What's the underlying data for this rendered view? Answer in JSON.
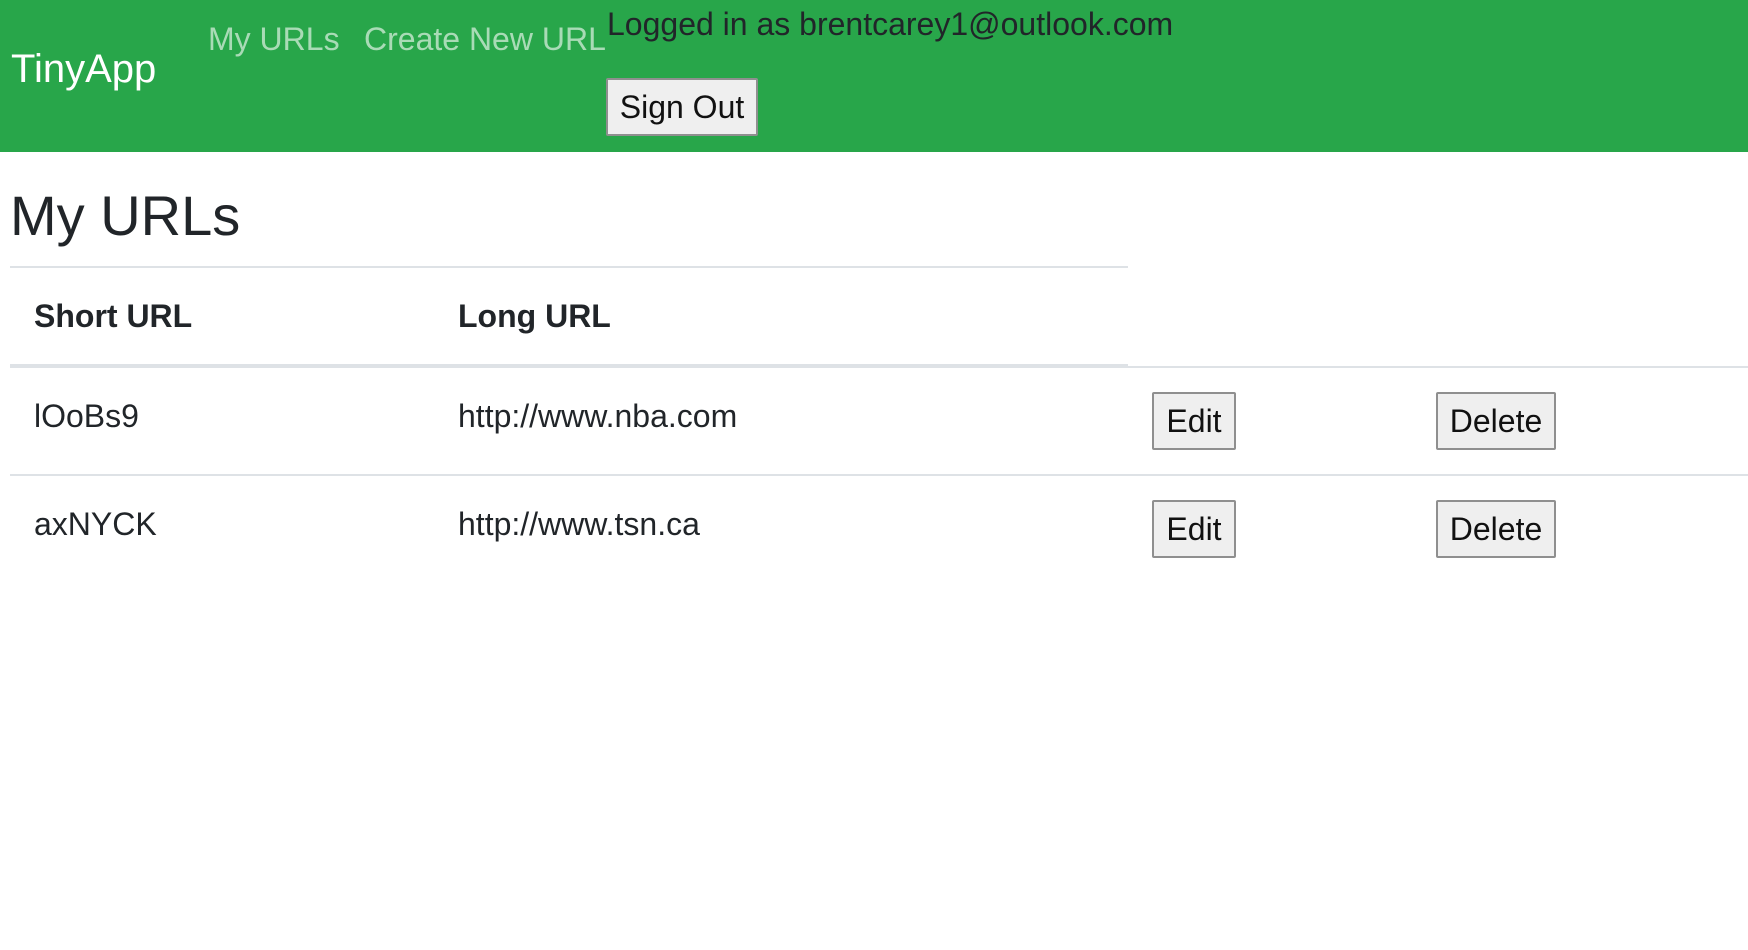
{
  "navbar": {
    "brand": "TinyApp",
    "links": [
      {
        "label": "My URLs"
      },
      {
        "label": "Create New URL"
      }
    ],
    "login_text": "Logged in as brentcarey1@outlook.com",
    "signout_label": "Sign Out"
  },
  "main": {
    "title": "My URLs",
    "table": {
      "headers": [
        "Short URL",
        "Long URL"
      ],
      "rows": [
        {
          "short": "lOoBs9",
          "long": "http://www.nba.com",
          "edit_label": "Edit",
          "delete_label": "Delete"
        },
        {
          "short": "axNYCK",
          "long": "http://www.tsn.ca",
          "edit_label": "Edit",
          "delete_label": "Delete"
        }
      ]
    }
  },
  "colors": {
    "navbar_bg": "#28a64a",
    "nav_link": "rgba(255,255,255,0.6)",
    "text": "#212529"
  }
}
